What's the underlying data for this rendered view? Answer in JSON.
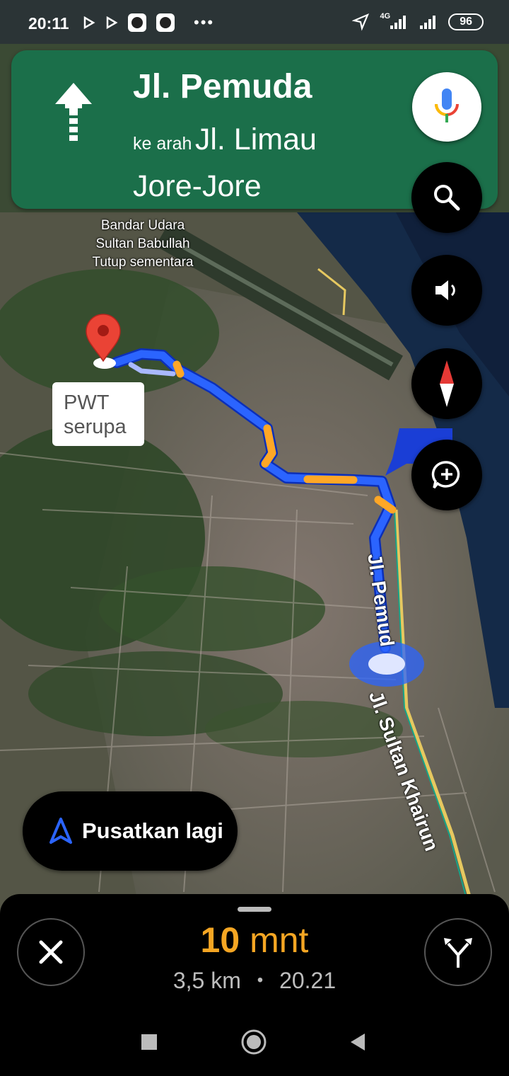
{
  "status_bar": {
    "time": "20:11",
    "network": "4G",
    "battery": "96"
  },
  "nav_banner": {
    "street": "Jl. Pemuda",
    "toward_prefix": "ke arah",
    "toward_street": "Jl. Limau Jore-Jore",
    "maneuver_icon": "straight-arrow-icon"
  },
  "map": {
    "airport_lines": [
      "Bandar Udara",
      "Sultan Babullah",
      "Tutup sementara"
    ],
    "destination_label": "PWT serupa",
    "road_labels": [
      "Jl. Pemud",
      "Jl. Sultan Khairun"
    ]
  },
  "side_buttons": [
    "search-icon",
    "volume-icon",
    "compass-icon",
    "add-report-icon"
  ],
  "recenter": {
    "label": "Pusatkan lagi"
  },
  "trip": {
    "duration_value": "10",
    "duration_unit": "mnt",
    "distance": "3,5 km",
    "separator": "•",
    "arrival": "20.21"
  },
  "colors": {
    "banner": "#1b6f4a",
    "eta": "#f5a623",
    "route": "#1a4cff",
    "traffic": "#ff9800"
  }
}
